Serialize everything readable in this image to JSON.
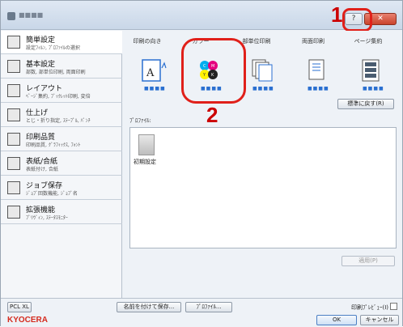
{
  "window": {
    "title": "■■■■",
    "help_label": "?",
    "close_label": "✕"
  },
  "callouts": {
    "one": "1",
    "two": "2"
  },
  "sidebar": {
    "items": [
      {
        "title": "簡単設定",
        "sub": "設定ﾌｨﾙﾝ, ﾌﾟﾛﾌｧｲﾙの選択",
        "icon": "quick-setup-icon"
      },
      {
        "title": "基本設定",
        "sub": "部数, 部単位印刷, 両面印刷",
        "icon": "basic-icon"
      },
      {
        "title": "レイアウト",
        "sub": "ﾍﾟｰｼﾞ集約, ﾌﾞｯｸﾚｯﾄ印刷, 変倍",
        "icon": "layout-icon"
      },
      {
        "title": "仕上げ",
        "sub": "とじ・折り指定, ｽﾃｰﾌﾟﾙ, ﾊﾟﾝﾁ",
        "icon": "finishing-icon"
      },
      {
        "title": "印刷品質",
        "sub": "印刷品質, ｸﾞﾗﾌｨｯｸｽ, ﾌｫﾝﾄ",
        "icon": "quality-icon"
      },
      {
        "title": "表紙/合紙",
        "sub": "表紙付け, 合紙",
        "icon": "cover-icon"
      },
      {
        "title": "ジョブ保存",
        "sub": "ｼﾞｮﾌﾞ回数機能, ｼﾞｮﾌﾞ名",
        "icon": "job-icon"
      },
      {
        "title": "拡張機能",
        "sub": "ﾌﾟﾘｳﾞｨﾝ, ｽﾃｰﾀｽﾓﾆﾀｰ",
        "icon": "advanced-icon"
      }
    ]
  },
  "tabs": {
    "headers": [
      "印刷の向き",
      "カラー",
      "部単位印刷",
      "両面印刷",
      "ページ集約"
    ],
    "dots": "■■■■"
  },
  "main": {
    "reset_label": "標準に戻す(R)",
    "profile_label": "ﾌﾟﾛﾌｧｲﾙ:",
    "profile_item": "初期設定",
    "apply_label": "適用(P)"
  },
  "footer": {
    "pcl_label": "PCL XL",
    "save_label": "名前を付けて保存...",
    "profile_label": "ﾌﾟﾛﾌｧｲﾙ...",
    "preview_label": "印刷ﾌﾟﾚﾋﾞｭｰ(I)",
    "logo": "KYOCERA",
    "ok_label": "OK",
    "cancel_label": "キャンセル"
  },
  "colors": {
    "callout_red": "#e0201a",
    "cyan": "#00aeef",
    "magenta": "#e4007f",
    "yellow": "#fff100",
    "black": "#222222"
  }
}
